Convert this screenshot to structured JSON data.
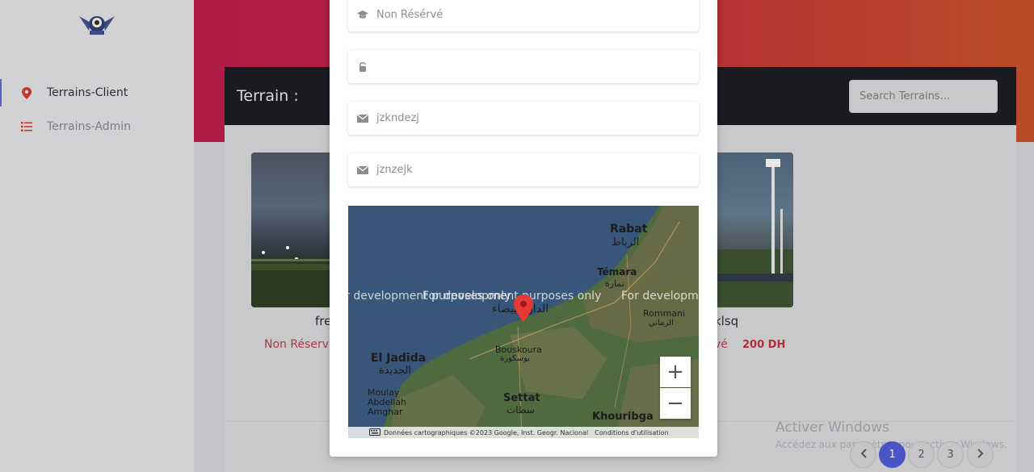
{
  "sidebar": {
    "items": [
      {
        "label": "Terrains-Client",
        "icon": "map-marker-icon",
        "active": true
      },
      {
        "label": "Terrains-Admin",
        "icon": "list-icon",
        "active": false
      }
    ]
  },
  "panel": {
    "title": "Terrain :",
    "search_placeholder": "Search Terrains..."
  },
  "cards": [
    {
      "name": "fre",
      "status": "Non Réserv"
    },
    {
      "name": "klsq",
      "status": "vé",
      "price": "200 DH"
    }
  ],
  "pagination": {
    "pages": [
      "1",
      "2",
      "3"
    ],
    "current": "1"
  },
  "watermark": {
    "line1": "Activer Windows",
    "line2": "Accédez aux paramètres pour activer Windows."
  },
  "modal": {
    "fields": [
      {
        "icon": "graduation-cap-icon",
        "value": "Non Résérvé"
      },
      {
        "icon": "lock-icon",
        "value": ""
      },
      {
        "icon": "envelope-icon",
        "value": "jzkndezj"
      },
      {
        "icon": "envelope-icon",
        "value": "jznzejk"
      }
    ],
    "map": {
      "dev_text": "For development purposes only",
      "places": {
        "rabat": "Rabat",
        "rabat_ar": "الرباط",
        "temara": "Témara",
        "temara_ar": "تمارة",
        "casa_ar": "الدار البيضاء",
        "rommani": "Rommani",
        "rommani_ar": "الرماني",
        "eljadida": "El Jadida",
        "eljadida_ar": "الجديدة",
        "bouskoura": "Bouskoura",
        "bouskoura_ar": "بوسكورة",
        "settat": "Settat",
        "settat_ar": "سطات",
        "khouribga": "Khouribga",
        "moulay": "Moulay",
        "abdellah": "Abdellah",
        "amghar": "Amghar"
      },
      "attribution": "Données cartographiques ©2023 Google, Inst. Geogr. Nacional",
      "terms": "Conditions d'utilisation",
      "zoom_in": "+",
      "zoom_out": "−"
    }
  }
}
